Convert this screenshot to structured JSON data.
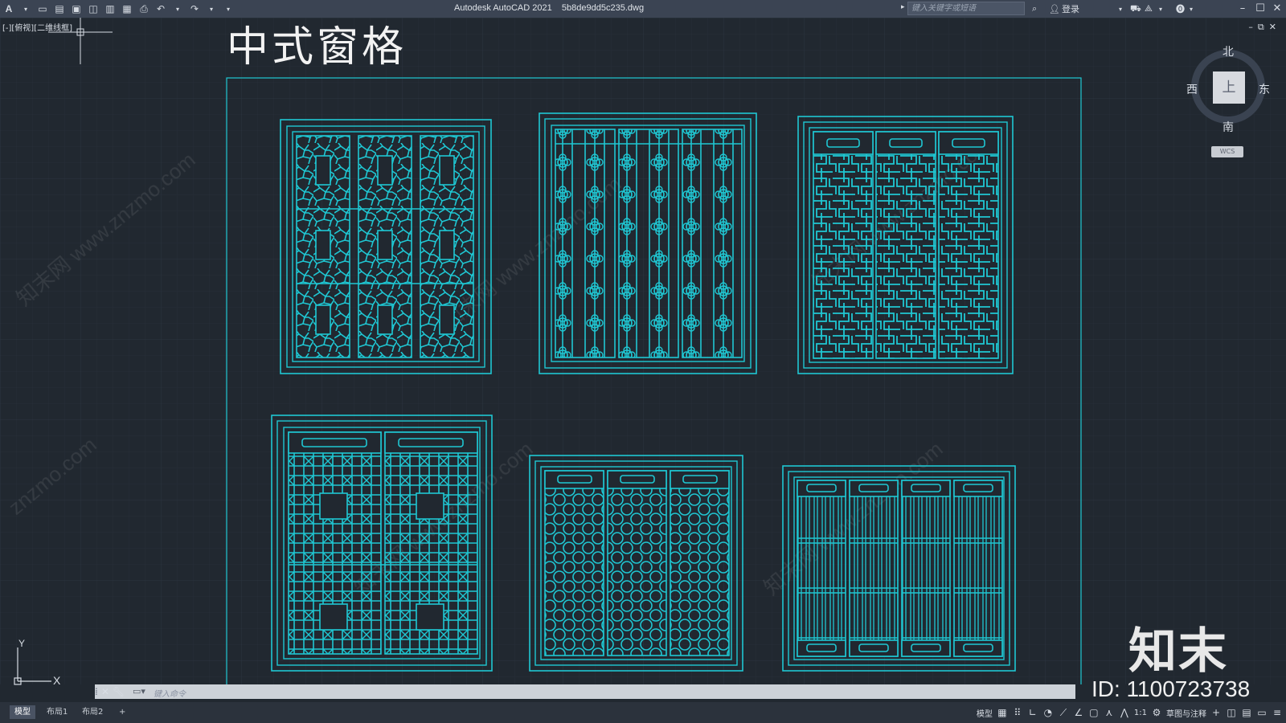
{
  "app": {
    "title": "Autodesk AutoCAD 2021    5b8de9dd5c235.dwg",
    "search_placeholder": "键入关键字或短语",
    "login_label": "登录",
    "quick_access_icons": [
      "new-icon",
      "open-icon",
      "save-icon",
      "save-as-icon",
      "plot-preview-icon",
      "publish-icon",
      "print-icon",
      "undo-icon",
      "redo-icon"
    ]
  },
  "viewport": {
    "label": "[-][俯视][二维线框]"
  },
  "drawing": {
    "title": "中式窗格",
    "accent_color": "#1fc7d3",
    "windows": [
      {
        "pattern": "cracked-ice",
        "panels": 3
      },
      {
        "pattern": "crabapple-flower",
        "panels": 3
      },
      {
        "pattern": "fret",
        "panels": 3
      },
      {
        "pattern": "lattice-square",
        "panels": 2
      },
      {
        "pattern": "interlocking-ring",
        "panels": 3
      },
      {
        "pattern": "vertical-bar",
        "panels": 4
      }
    ]
  },
  "viewcube": {
    "face": "上",
    "north": "北",
    "south": "南",
    "east": "东",
    "west": "西",
    "wcs": "WCS"
  },
  "ucs": {
    "x": "X",
    "y": "Y"
  },
  "watermark": {
    "brand": "知末",
    "id": "ID: 1100723738"
  },
  "command": {
    "placeholder": "键入命令"
  },
  "tabs": [
    {
      "label": "模型",
      "active": true
    },
    {
      "label": "布局1",
      "active": false
    },
    {
      "label": "布局2",
      "active": false
    }
  ],
  "status": {
    "model_label": "模型",
    "scale": "1:1",
    "workspace": "草图与注释"
  }
}
